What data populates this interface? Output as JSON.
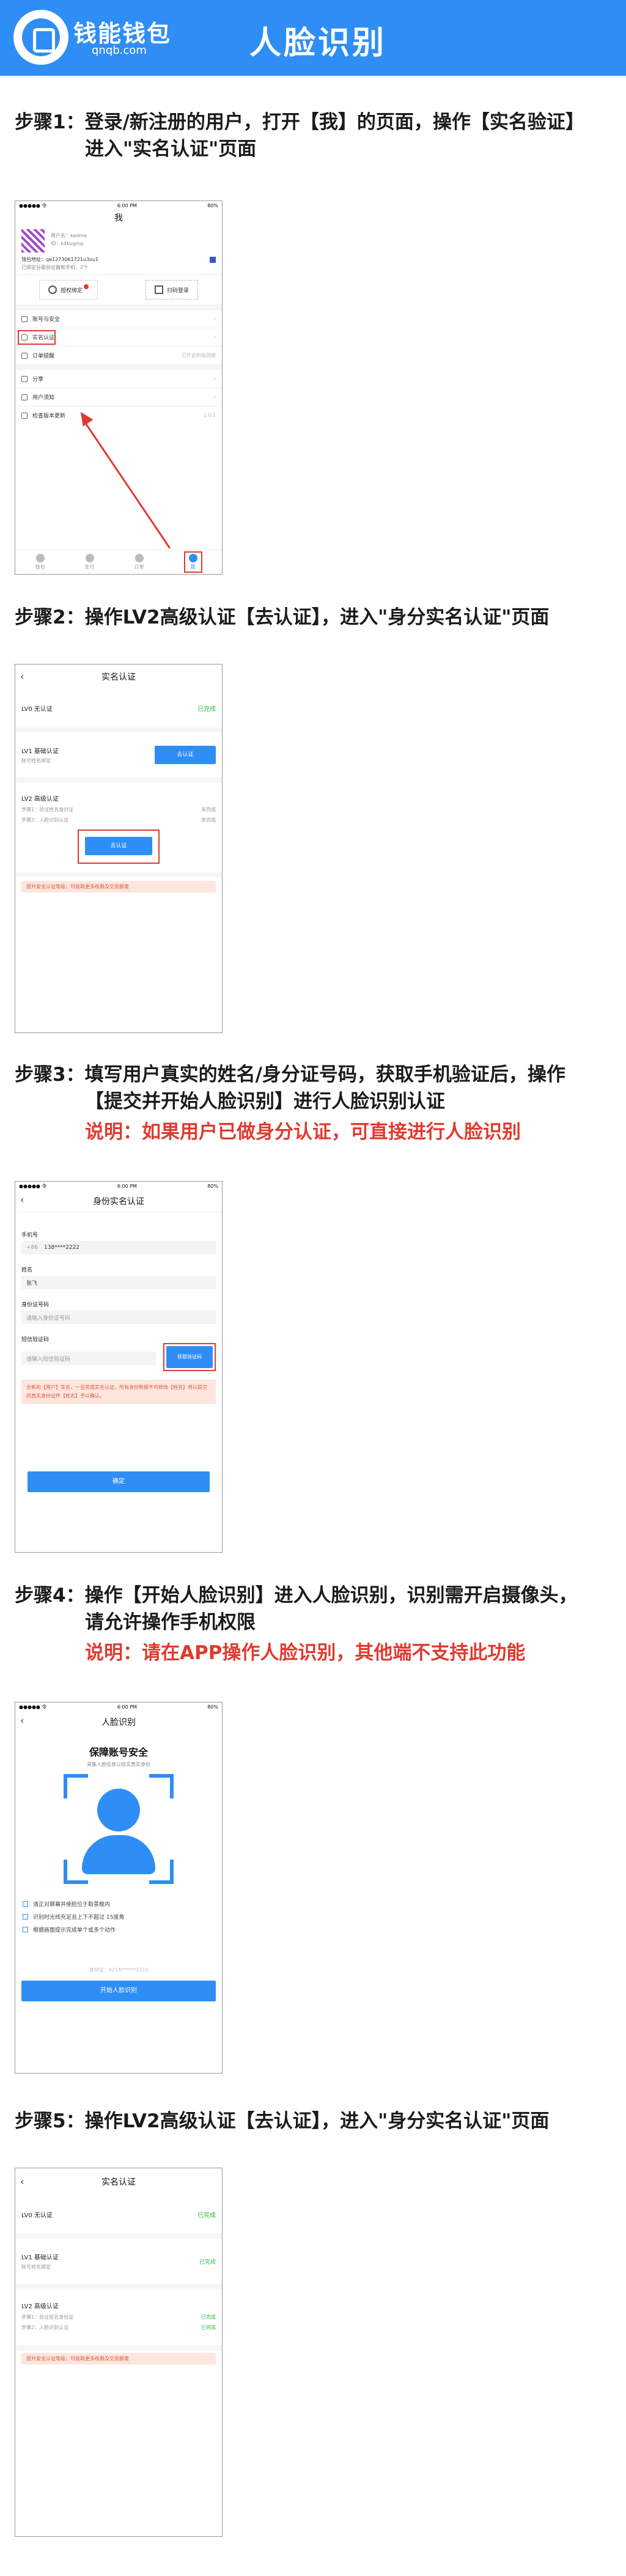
{
  "header": {
    "logo_name": "钱能钱包",
    "logo_domain": "qnqb.com",
    "title": "人脸识别"
  },
  "steps": [
    {
      "label": "步骤1：",
      "text": "登录/新注册的用户，打开【我】的页面，操作【实名验证】",
      "cont": "进入\"实名认证\"页面",
      "note": ""
    },
    {
      "label": "步骤2：",
      "text": "操作LV2高级认证【去认证】，进入\"身分实名认证\"页面",
      "cont": "",
      "note": ""
    },
    {
      "label": "步骤3：",
      "text": "填写用户真实的姓名/身分证号码，获取手机验证后，操作",
      "cont": "【提交并开始人脸识别】进行人脸识别认证",
      "note": "说明：如果用户已做身分认证，可直接进行人脸识别"
    },
    {
      "label": "步骤4：",
      "text": "操作【开始人脸识别】进入人脸识别，识别需开启摄像头，",
      "cont": "请允许操作手机权限",
      "note": "说明：请在APP操作人脸识别，其他端不支持此功能"
    },
    {
      "label": "步骤5：",
      "text": "操作LV2高级认证【去认证】，进入\"身分实名认证\"页面",
      "cont": "",
      "note": ""
    }
  ],
  "status_bar": {
    "carrier": "●●●●● 令",
    "time": "6:00 PM",
    "battery": "80%"
  },
  "phone1": {
    "title": "我",
    "user_name": "用户名：kedma",
    "user_id": "ID：k4kugmp",
    "wallet_addr": "钱包地址：qe1273061721u3ou1",
    "bind_hint": "已绑定谷歌验证器和手机：2个",
    "btn_bind": "授权绑定",
    "btn_scan": "扫码登录",
    "menu": [
      {
        "label": "账号与安全",
        "right": ""
      },
      {
        "label": "实名认证",
        "right": ""
      },
      {
        "label": "订单提醒",
        "right": "已开启积极提醒"
      },
      {
        "label": "分享",
        "right": ""
      },
      {
        "label": "用户须知",
        "right": ""
      },
      {
        "label": "检查版本更新",
        "right": "1.0.1"
      }
    ],
    "tabs": [
      "钱包",
      "支付",
      "订单",
      "我"
    ]
  },
  "lv_page": {
    "title": "实名认证",
    "lv0": "LV0 无认证",
    "lv0_status": "已完成",
    "lv1": "LV1 基础认证",
    "lv1_sub": "账号姓名绑定",
    "lv1_btn": "去认证",
    "lv1_status": "已完成",
    "lv2": "LV2 高级认证",
    "lv2_step1": "步骤1：验证姓名身份证",
    "lv2_step2": "步骤2：人脸识别认证",
    "lv2_pending": "未完成",
    "lv2_done": "已完成",
    "lv2_btn": "去认证",
    "tip": "提升安全认证等级，可获取更多权限及交易额度"
  },
  "form": {
    "title": "身份实名认证",
    "phone_label": "手机号",
    "phone_prefix": "+86",
    "phone_value": "138****2222",
    "name_label": "姓名",
    "name_value": "张飞",
    "id_label": "身份证号码",
    "id_placeholder": "请输入身份证号码",
    "code_label": "短信验证码",
    "code_placeholder": "请输入短信验证码",
    "code_btn": "获取验证码",
    "warn": "全新的【用户】实名，一旦完成实名认证，所有身份数据不可修改【姓名】将以提交的真实身份证件【姓名】予以确认。",
    "submit": "确定"
  },
  "face": {
    "title": "人脸识别",
    "heading": "保障账号安全",
    "sub": "采集人脸信息以核实真实身份",
    "hints": [
      "请正对屏幕并使脸位于取景框内",
      "识别时光线充足且上下不超过 15度角",
      "根据画面提示完成单个或多个动作"
    ],
    "id_line": "身份证：4214******2222",
    "btn": "开始人脸识别"
  }
}
